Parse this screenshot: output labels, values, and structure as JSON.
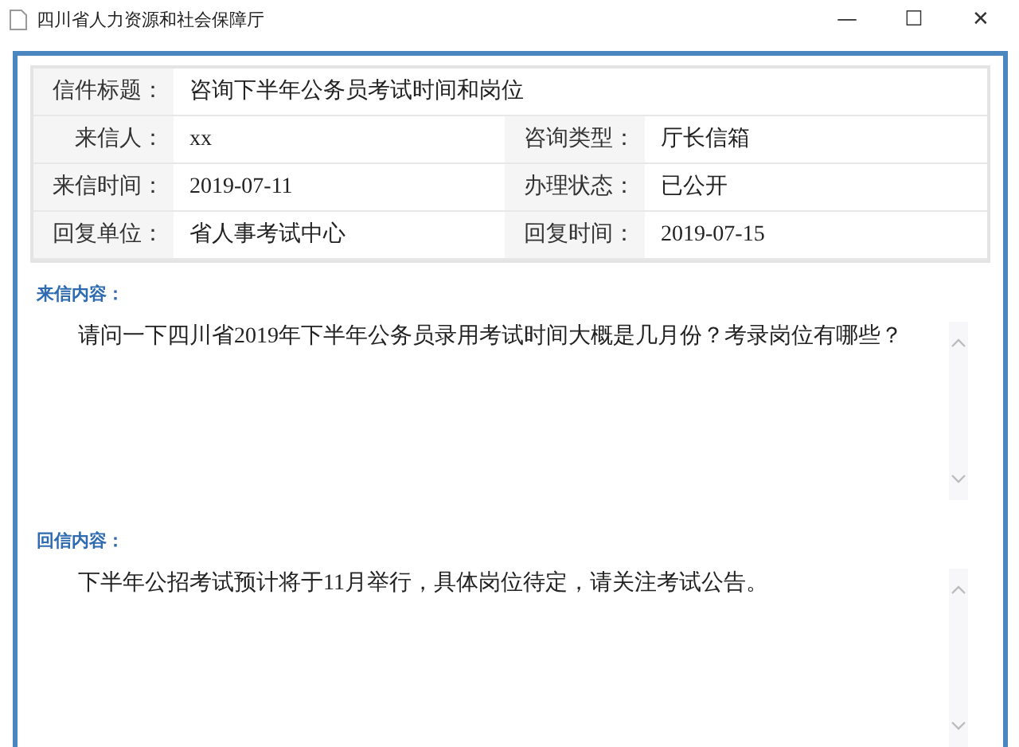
{
  "window": {
    "title": "四川省人力资源和社会保障厅",
    "controls": [
      "—",
      "☐",
      "✕"
    ]
  },
  "info": {
    "title_row": {
      "label": "信件标题：",
      "value": "咨询下半年公务员考试时间和岗位"
    },
    "rows": [
      {
        "label": "来信人：",
        "value": "xx",
        "label_2": "咨询类型：",
        "value_2": "厅长信箱"
      },
      {
        "label": "来信时间：",
        "value": "2019-07-11",
        "label_2": "办理状态：",
        "value_2": "已公开"
      },
      {
        "label": "回复单位：",
        "value": "省人事考试中心",
        "label_2": "回复时间：",
        "value_2": "2019-07-15"
      }
    ]
  },
  "sections": [
    {
      "heading": "来信内容：",
      "text": "请问一下四川省2019年下半年公务员录用考试时间大概是几月份？考录岗位有哪些？"
    },
    {
      "heading": "回信内容：",
      "text": "下半年公招考试预计将于11月举行，具体岗位待定，请关注考试公告。"
    }
  ]
}
